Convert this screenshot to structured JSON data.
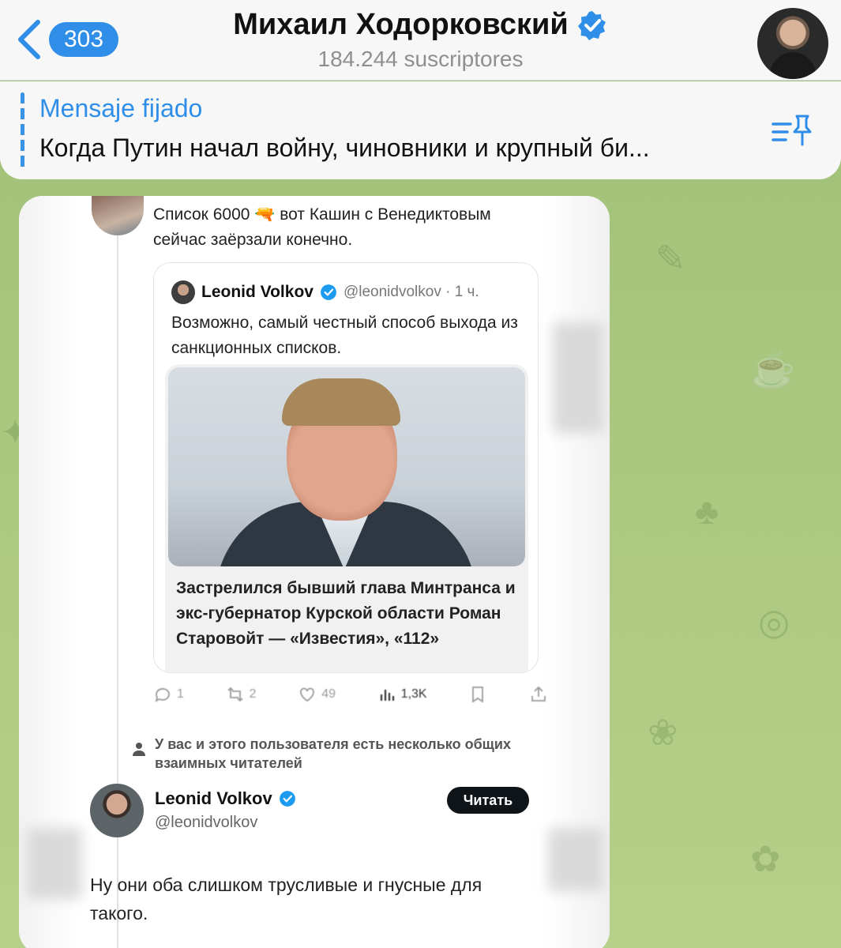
{
  "header": {
    "back_count": "303",
    "channel_name": "Михаил Ходорковский",
    "subscribers": "184.244 suscriptores"
  },
  "pinned": {
    "label": "Mensaje fijado",
    "text": "Когда Путин начал войну, чиновники и крупный би..."
  },
  "post": {
    "reply_text": "Список 6000 🔫 вот Кашин с Венедиктовым сейчас заёрзали конечно.",
    "quote": {
      "name": "Leonid Volkov",
      "handle": "@leonidvolkov · 1 ч.",
      "text": "Возможно, самый честный способ выхода из санкционных списков.",
      "news_title": "Застрелился бывший глава Минтранса и экс-губернатор Курской области Роман Старовойт — «Известия», «112»"
    },
    "actions": {
      "replies": "1",
      "reposts": "2",
      "likes": "49",
      "views": "1,3K"
    },
    "mutual_notice": "У вас и этого пользователя есть несколько общих взаимных читателей",
    "profile": {
      "name": "Leonid Volkov",
      "handle": "@leonidvolkov",
      "follow_label": "Читать"
    },
    "reply_body": "Ну они оба слишком трусливые и гнусные для такого."
  },
  "colors": {
    "accent": "#2f8ee8",
    "background": "#a9c77e",
    "follow_button": "#0f1419"
  }
}
